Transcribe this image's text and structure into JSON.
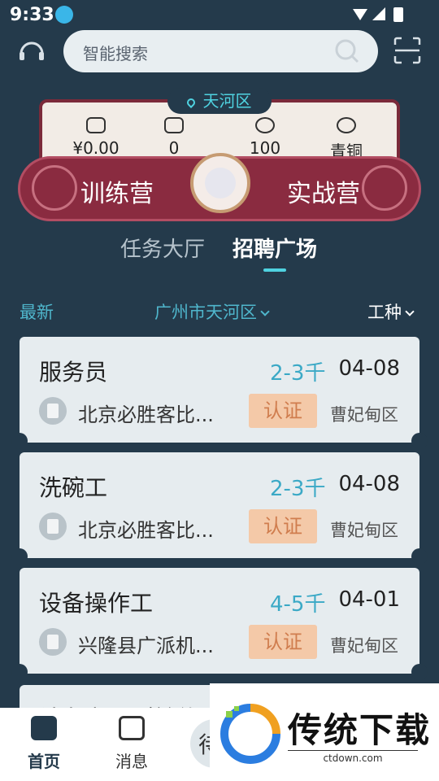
{
  "status_bar": {
    "time": "9:33"
  },
  "search": {
    "placeholder": "智能搜索"
  },
  "location": {
    "district": "天河区"
  },
  "stats": [
    {
      "icon": "wallet-icon",
      "value": "¥0.00"
    },
    {
      "icon": "hours-icon",
      "value": "0"
    },
    {
      "icon": "star-points-icon",
      "value": "100"
    },
    {
      "icon": "rank-badge-icon",
      "value": "青铜"
    }
  ],
  "banner": {
    "left_label": "训练营",
    "right_label": "实战营"
  },
  "tabs": [
    {
      "label": "任务大厅",
      "active": false
    },
    {
      "label": "招聘广场",
      "active": true
    }
  ],
  "filters": {
    "latest": "最新",
    "area": "广州市天河区",
    "job_type": "工种"
  },
  "jobs": [
    {
      "title": "服务员",
      "salary": "2-3千",
      "date": "04-08",
      "company": "北京必胜客比...",
      "badge": "认证",
      "district": "曹妃甸区"
    },
    {
      "title": "洗碗工",
      "salary": "2-3千",
      "date": "04-08",
      "company": "北京必胜客比...",
      "badge": "认证",
      "district": "曹妃甸区"
    },
    {
      "title": "设备操作工",
      "salary": "4-5千",
      "date": "04-01",
      "company": "兴隆县广派机...",
      "badge": "认证",
      "district": "曹妃甸区"
    }
  ],
  "partial_job": {
    "title": "计务专员（兼什"
  },
  "bottom_nav": {
    "home": "首页",
    "messages": "消息",
    "center": "待"
  },
  "watermark": {
    "brand": "传统下载",
    "url": "ctdown.com"
  },
  "colors": {
    "background": "#243a4b",
    "accent": "#4fd2e0",
    "banner": "#8a2b40",
    "badge": "#f4c9a8"
  }
}
